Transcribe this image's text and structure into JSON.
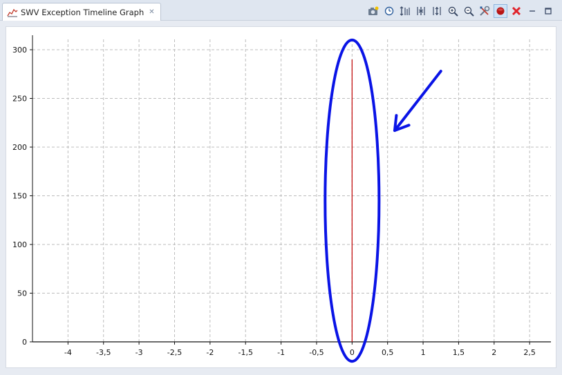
{
  "window": {
    "tab_title": "SWV Exception Timeline Graph"
  },
  "toolbar": {
    "buttons": [
      {
        "name": "snapshot-camera-icon"
      },
      {
        "name": "clock-icon"
      },
      {
        "name": "scale-vertical-icon"
      },
      {
        "name": "collapse-horizontal-icon"
      },
      {
        "name": "expand-horizontal-icon"
      },
      {
        "name": "zoom-in-icon"
      },
      {
        "name": "zoom-out-icon"
      },
      {
        "name": "configure-tools-icon"
      },
      {
        "name": "record-start-icon"
      },
      {
        "name": "clear-red-x-icon"
      },
      {
        "name": "minimize-icon"
      },
      {
        "name": "maximize-icon"
      }
    ],
    "active_button": "record-start-icon"
  },
  "chart_data": {
    "type": "line",
    "title": "",
    "xlabel": "",
    "ylabel": "",
    "xlim": [
      -4.5,
      2.8
    ],
    "ylim": [
      0,
      300
    ],
    "x_ticks": [
      -4,
      -3.5,
      -3,
      -2.5,
      -2,
      -1.5,
      -1,
      -0.5,
      0,
      0.5,
      1,
      1.5,
      2,
      2.5
    ],
    "x_tick_labels": [
      "-4",
      "-3,5",
      "-3",
      "-2,5",
      "-2",
      "-1,5",
      "-1",
      "-0,5",
      "0",
      "0,5",
      "1",
      "1,5",
      "2",
      "2,5"
    ],
    "y_ticks": [
      0,
      50,
      100,
      150,
      200,
      250,
      300
    ],
    "y_tick_labels": [
      "0",
      "50",
      "100",
      "150",
      "200",
      "250",
      "300"
    ],
    "grid": true,
    "series": [
      {
        "color": "#c00000",
        "x": [
          0,
          0
        ],
        "y": [
          0,
          290
        ]
      }
    ],
    "annotations": [
      {
        "type": "ellipse",
        "color": "#0a14e6",
        "center_x": 0,
        "center_y": 145,
        "rx": 0.38,
        "ry": 165
      },
      {
        "type": "arrow",
        "color": "#0a14e6",
        "from_x": 1.25,
        "from_y": 278,
        "to_x": 0.6,
        "to_y": 217
      }
    ]
  },
  "colors": {
    "accent_blue": "#0a14e6",
    "series_red": "#c00000",
    "grid": "#bcbcbc"
  }
}
